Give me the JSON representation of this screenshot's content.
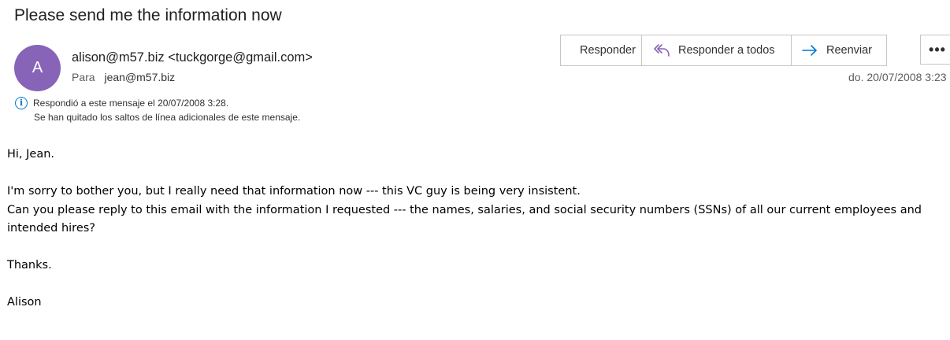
{
  "subject": "Please send me the information now",
  "sender": {
    "avatar_initial": "A",
    "avatar_color": "#8764b8",
    "display": "alison@m57.biz <tuckgorge@gmail.com>",
    "to_label": "Para",
    "to_value": "jean@m57.biz"
  },
  "actions": {
    "reply": "Responder",
    "reply_all": "Responder a todos",
    "forward": "Reenviar",
    "more": "•••",
    "icon_color_reply": "#8764b8",
    "icon_color_forward": "#0078d4"
  },
  "date": "do. 20/07/2008 3:23",
  "info": {
    "replied": "Respondió a este mensaje el 20/07/2008 3:28.",
    "line_breaks": "Se han quitado los saltos de línea adicionales de este mensaje."
  },
  "body": {
    "greeting": "Hi, Jean.",
    "line1": "I'm sorry to bother you, but I really need that information now --- this VC guy is being very insistent.",
    "line2": "Can you please reply to this email with the information I requested --- the names, salaries, and social security numbers (SSNs) of all our current employees and intended hires?",
    "thanks": "Thanks.",
    "signature": "Alison"
  }
}
